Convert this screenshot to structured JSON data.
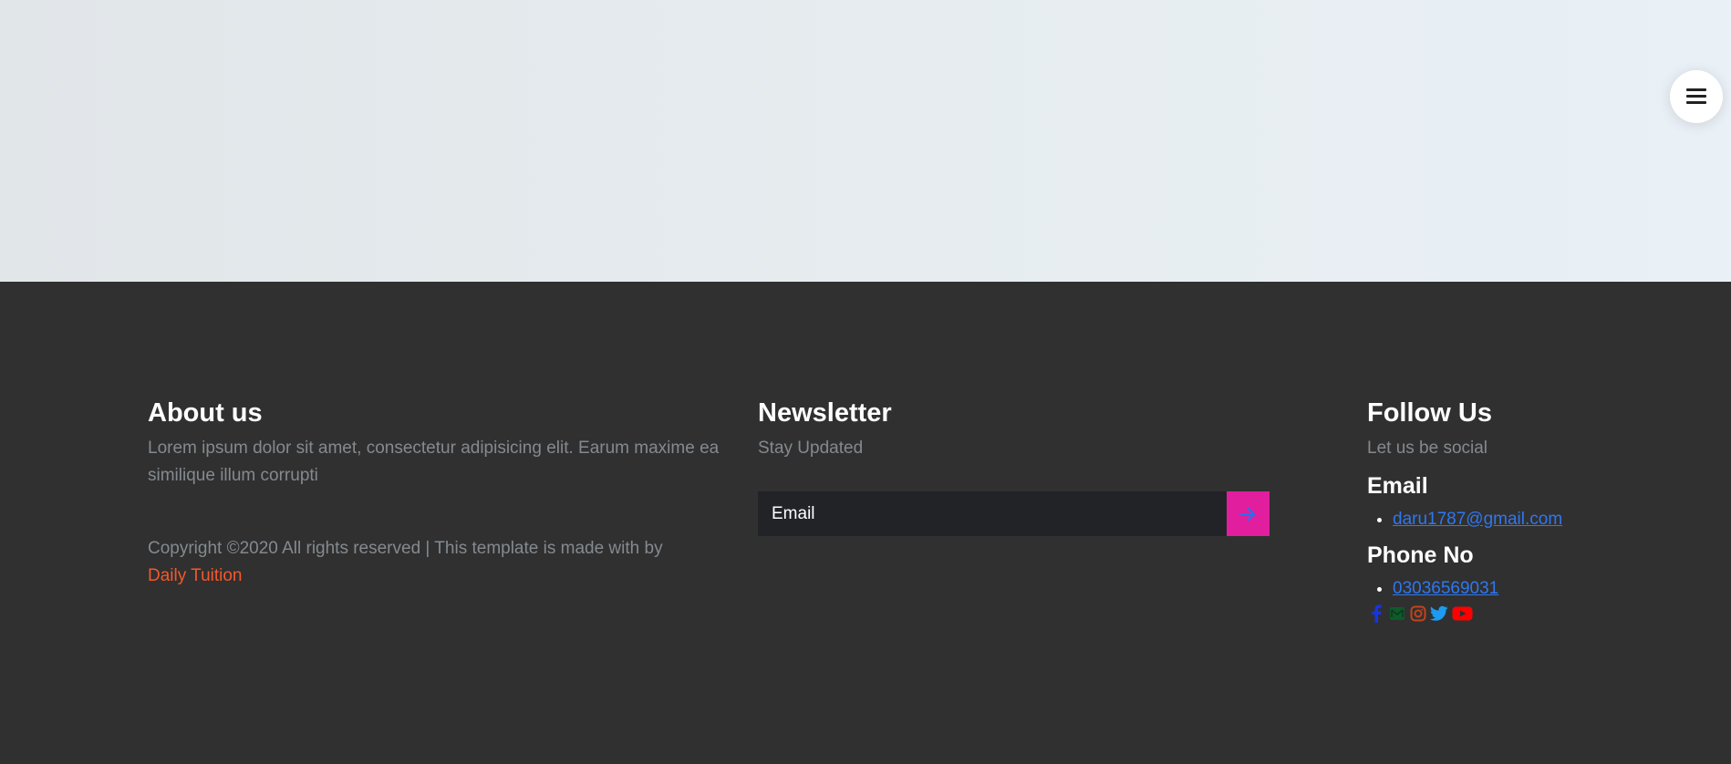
{
  "hero": {
    "menu_icon": "hamburger-menu-icon"
  },
  "about": {
    "heading": "About us",
    "description": "Lorem ipsum dolor sit amet, consectetur adipisicing elit. Earum maxime ea similique illum corrupti",
    "copyright_prefix": "Copyright ©2020 All rights reserved | This template is made with by",
    "copyright_link": "Daily Tuition"
  },
  "newsletter": {
    "heading": "Newsletter",
    "subtitle": "Stay Updated",
    "email_placeholder": "Email",
    "email_value": "",
    "submit_icon": "arrow-right-icon"
  },
  "follow": {
    "heading": "Follow Us",
    "subtitle": "Let us be social",
    "email_heading": "Email",
    "email_link": "daru1787@gmail.com",
    "phone_heading": "Phone No",
    "phone_link": "03036569031",
    "social_icons": [
      "facebook-icon",
      "gmail-icon",
      "instagram-icon",
      "twitter-icon",
      "youtube-icon"
    ]
  },
  "colors": {
    "footer_bg": "#303030",
    "muted_text": "#848a8f",
    "accent_link": "#f4582c",
    "submit_bg": "#e01e9e",
    "link_blue": "#2f77f0"
  }
}
